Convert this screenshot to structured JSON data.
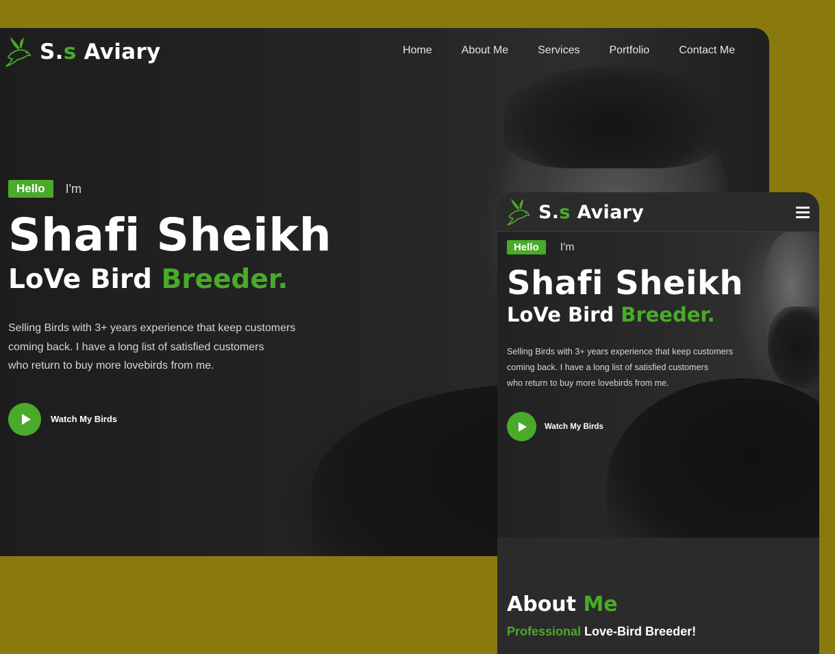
{
  "colors": {
    "accent": "#4aaa2a",
    "backdrop": "#8a7a0e",
    "panel": "#2b2b2b"
  },
  "brand": {
    "prefix": "S.",
    "highlight": "s",
    "suffix": " Aviary",
    "icon": "bird-logo-icon"
  },
  "desktop": {
    "nav": [
      "Home",
      "About Me",
      "Services",
      "Portfolio",
      "Contact Me"
    ],
    "hero": {
      "badge": "Hello",
      "greeting": "I'm",
      "name": "Shafi Sheikh",
      "role_white": "LoVe Bird ",
      "role_green": "Breeder.",
      "description": [
        "Selling Birds with 3+ years experience that keep customers",
        "coming back. I have a long list of satisfied customers",
        "who return to buy more lovebirds from me."
      ],
      "cta": "Watch My Birds"
    }
  },
  "mobile": {
    "menu_icon": "hamburger-menu-icon",
    "hero": {
      "badge": "Hello",
      "greeting": "I'm",
      "name": "Shafi Sheikh",
      "role_white": "LoVe Bird ",
      "role_green": "Breeder.",
      "description": [
        "Selling Birds with 3+ years experience that keep customers",
        "coming back. I have a long list of satisfied customers",
        "who return to buy more lovebirds from me."
      ],
      "cta": "Watch My Birds"
    },
    "about": {
      "title_white": "About ",
      "title_green": "Me",
      "subtitle_green": "Professional",
      "subtitle_white": " Love-Bird Breeder!"
    }
  }
}
